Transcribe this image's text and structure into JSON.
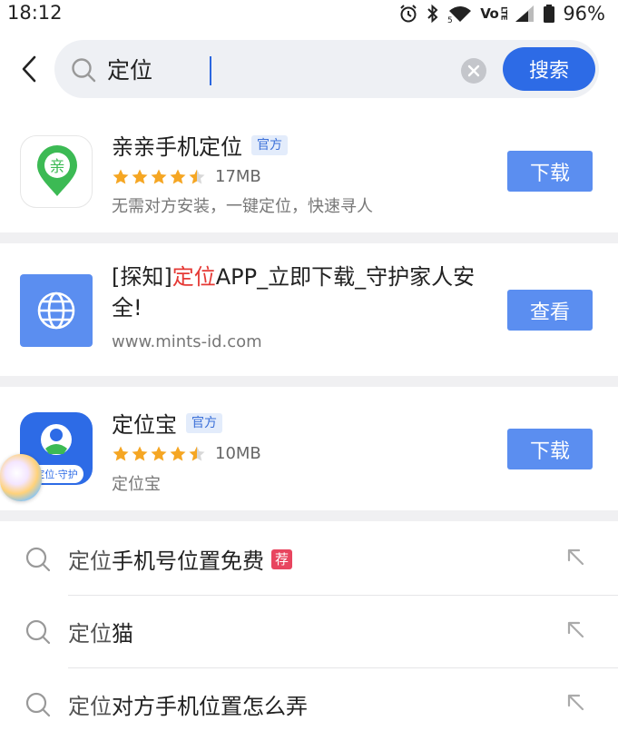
{
  "status_bar": {
    "time": "18:12",
    "network_label": "Vo",
    "lte_label": "LTE",
    "signal_sub": "5",
    "battery": "96%"
  },
  "search": {
    "query": "定位",
    "button_label": "搜索"
  },
  "results": [
    {
      "title": "亲亲手机定位",
      "badge": "官方",
      "rating": 4.5,
      "size": "17MB",
      "desc": "无需对方安装，一键定位，快速寻人",
      "button": "下载",
      "icon_name": "qinqin-location-app-icon",
      "icon_char": "亲",
      "icon_color": "#3cba54"
    },
    {
      "title_prefix": "[探知]",
      "title_highlight": "定位",
      "title_suffix": "APP_立即下载_守护家人安全!",
      "url": "www.mints-id.com",
      "button": "查看",
      "icon_name": "globe-icon"
    },
    {
      "title": "定位宝",
      "badge": "官方",
      "rating": 4.5,
      "size": "10MB",
      "desc": "定位宝",
      "button": "下载",
      "icon_name": "dingweibao-app-icon",
      "icon_caption": "定位·守护",
      "icon_color": "#2d6be6"
    }
  ],
  "suggestions": [
    {
      "match": "定位",
      "rest": "手机号位置免费",
      "tag": "荐"
    },
    {
      "match": "定位",
      "rest": "猫",
      "tag": ""
    },
    {
      "match": "定位",
      "rest": "对方手机位置怎么弄",
      "tag": ""
    }
  ],
  "colors": {
    "accent": "#2d6be6",
    "button": "#5b8ef0",
    "star": "#f5a623",
    "highlight": "#e53935",
    "tag": "#e8455f"
  }
}
